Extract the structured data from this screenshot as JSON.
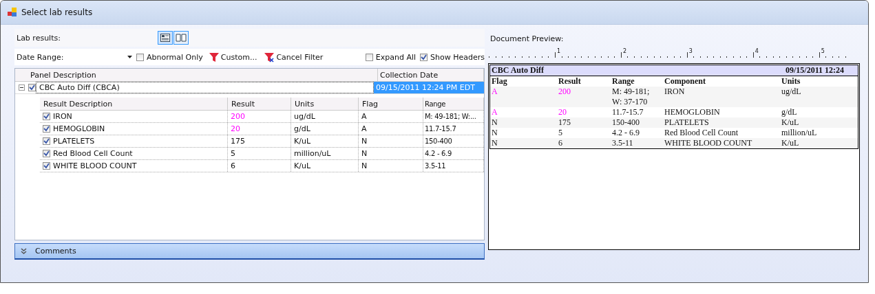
{
  "window": {
    "title": "Select lab results"
  },
  "lab_results_label": "Lab results:",
  "view_buttons": [
    {
      "kind": "form",
      "selected": true
    },
    {
      "kind": "book",
      "selected": false
    }
  ],
  "date_range": {
    "label": "Date Range:"
  },
  "abnormal_only": {
    "label": "Abnormal Only",
    "checked": false
  },
  "filter_buttons": [
    {
      "kind": "custom",
      "label": "Custom..."
    },
    {
      "kind": "cancel",
      "label": "Cancel Filter"
    }
  ],
  "expand_all": {
    "label": "Expand All",
    "checked": false
  },
  "show_headers": {
    "label": "Show Headers",
    "checked": true
  },
  "grid": {
    "columns": [
      "Panel Description",
      "Collection Date"
    ],
    "panels": [
      {
        "description": "CBC Auto Diff (CBCA)",
        "checked": true,
        "expanded": true,
        "selected": true,
        "collection_date": "09/15/2011 12:24 PM EDT",
        "result_columns": [
          "Result Description",
          "Result",
          "Units",
          "Flag",
          "Range"
        ],
        "results": [
          {
            "description": "IRON",
            "checked": true,
            "result": "200",
            "abnormal": true,
            "units": "ug/dL",
            "flag": "A",
            "range": "M: 49-181; W:..."
          },
          {
            "description": "HEMOGLOBIN",
            "checked": true,
            "result": "20",
            "abnormal": true,
            "units": "g/dL",
            "flag": "A",
            "range": "11.7-15.7"
          },
          {
            "description": "PLATELETS",
            "checked": true,
            "result": "175",
            "abnormal": false,
            "units": "K/uL",
            "flag": "N",
            "range": "150-400"
          },
          {
            "description": "Red Blood Cell Count",
            "checked": true,
            "result": "5",
            "abnormal": false,
            "units": "million/uL",
            "flag": "N",
            "range": "4.2 - 6.9"
          },
          {
            "description": "WHITE BLOOD COUNT",
            "checked": true,
            "result": "6",
            "abnormal": false,
            "units": "K/uL",
            "flag": "N",
            "range": "3.5-11"
          }
        ]
      }
    ]
  },
  "comments": {
    "label": "Comments",
    "expanded": false
  },
  "preview": {
    "label": "Document Preview:",
    "ruler": [
      "1",
      "2",
      "3",
      "4",
      "5"
    ],
    "report": {
      "title": "CBC Auto Diff",
      "date": "09/15/2011 12:24",
      "columns": [
        "Flag",
        "Result",
        "Range",
        "Component",
        "Units"
      ],
      "rows": [
        {
          "flag": "A",
          "result": "200",
          "abnormal": true,
          "range": [
            "M: 49-181;",
            "W: 37-170"
          ],
          "component": "IRON",
          "units": "ug/dL"
        },
        {
          "flag": "A",
          "result": "20",
          "abnormal": true,
          "range": [
            "11.7-15.7"
          ],
          "component": "HEMOGLOBIN",
          "units": "g/dL"
        },
        {
          "flag": "N",
          "result": "175",
          "abnormal": false,
          "range": [
            "150-400"
          ],
          "component": "PLATELETS",
          "units": "K/uL"
        },
        {
          "flag": "N",
          "result": "5",
          "abnormal": false,
          "range": [
            "4.2 - 6.9"
          ],
          "component": "Red Blood Cell Count",
          "units": "million/uL"
        },
        {
          "flag": "N",
          "result": "6",
          "abnormal": false,
          "range": [
            "3.5-11"
          ],
          "component": "WHITE BLOOD COUNT",
          "units": "K/uL"
        }
      ]
    }
  }
}
